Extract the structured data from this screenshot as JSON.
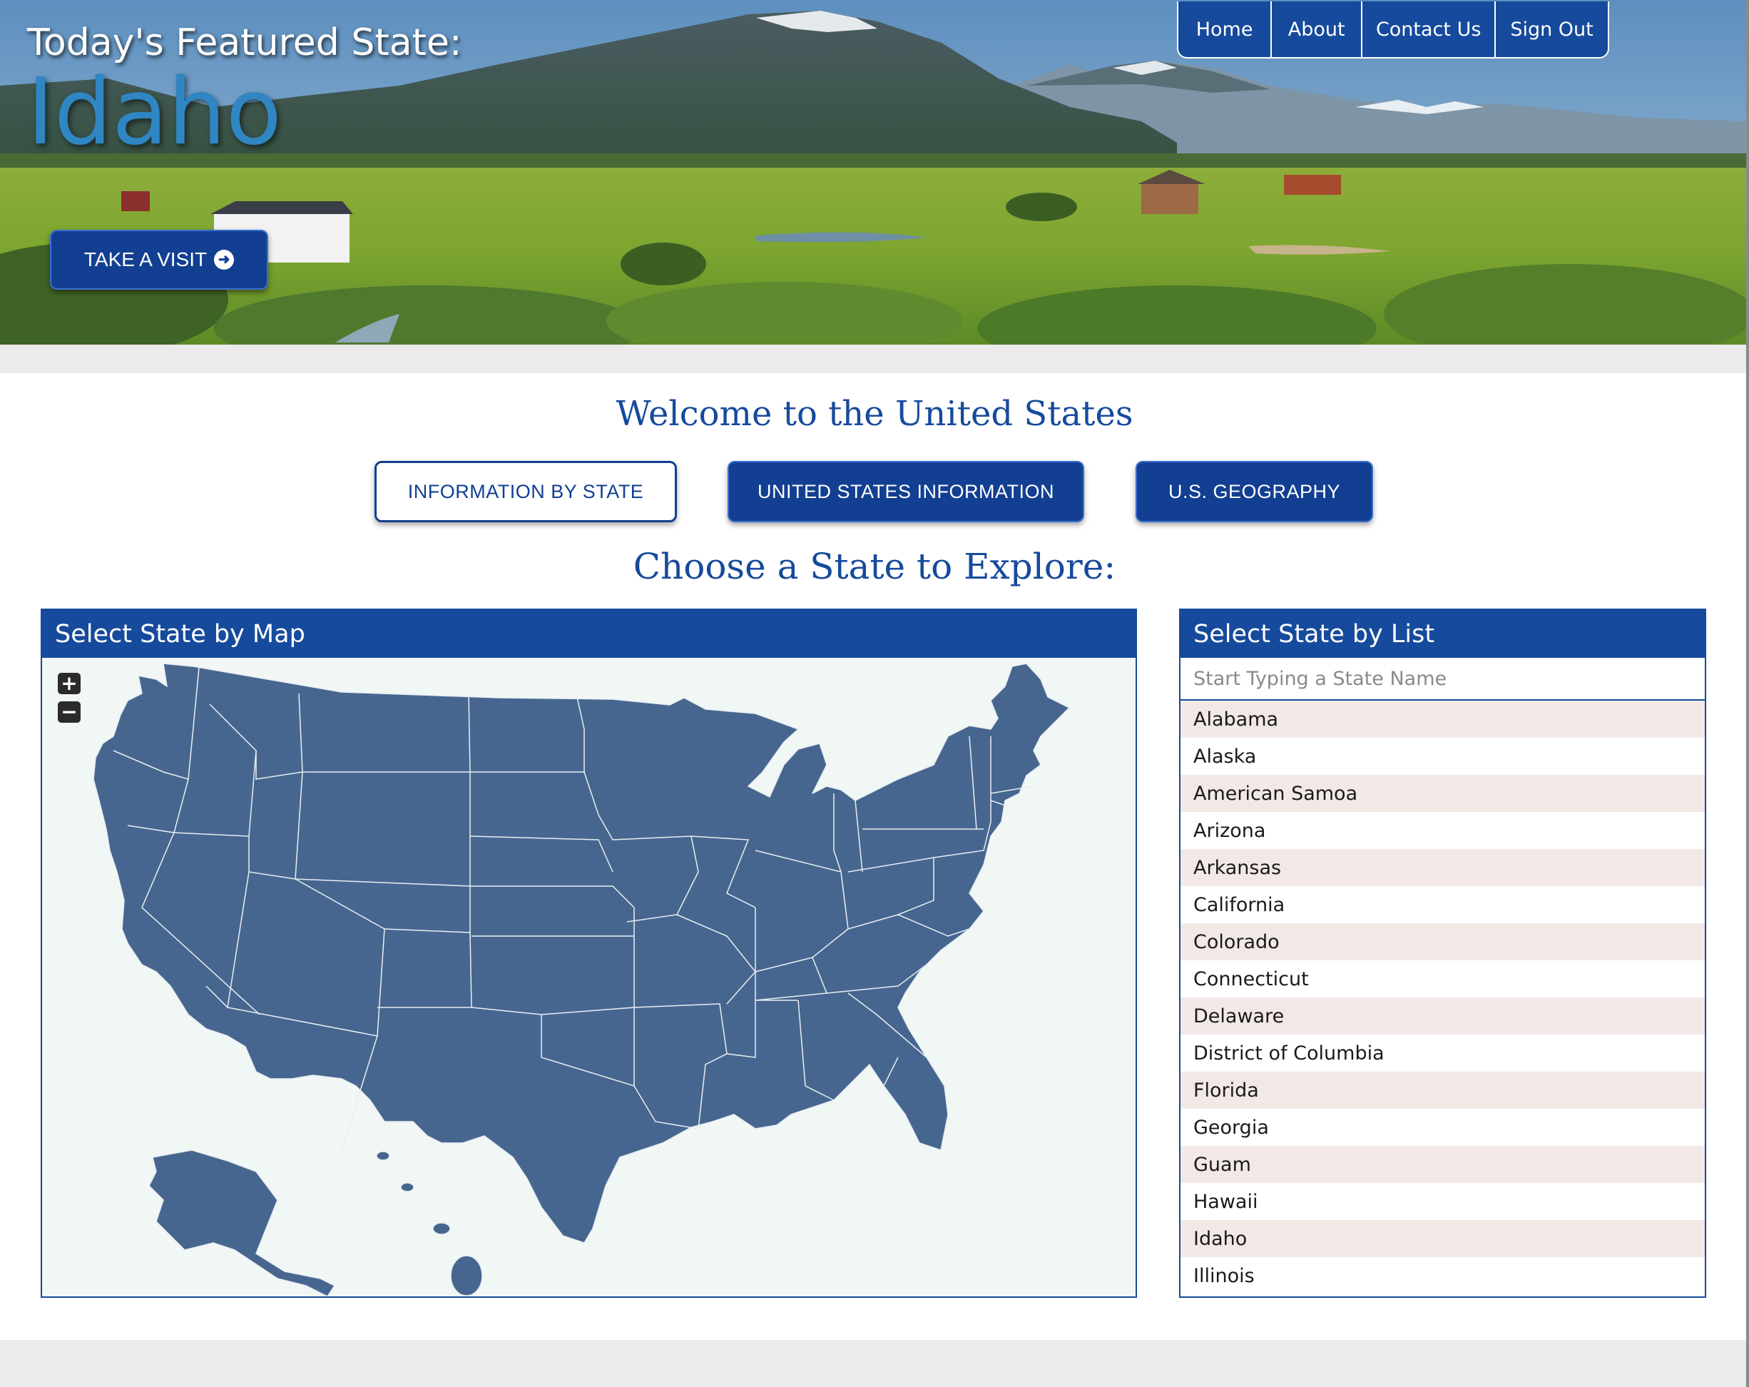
{
  "hero": {
    "featured_label": "Today's Featured State:",
    "featured_state": "Idaho",
    "visit_button": "TAKE A VISIT",
    "visit_icon": "arrow-circle-right-icon"
  },
  "nav": {
    "items": [
      "Home",
      "About",
      "Contact Us",
      "Sign Out"
    ]
  },
  "main": {
    "welcome_heading": "Welcome to the United States",
    "tabs": [
      {
        "label": "INFORMATION BY STATE",
        "active": true
      },
      {
        "label": "UNITED STATES INFORMATION",
        "active": false
      },
      {
        "label": "U.S. GEOGRAPHY",
        "active": false
      }
    ],
    "choose_heading": "Choose a State to Explore:"
  },
  "map_panel": {
    "title": "Select State by Map",
    "zoom_in": "+",
    "zoom_out": "−"
  },
  "list_panel": {
    "title": "Select State by List",
    "search_placeholder": "Start Typing a State Name",
    "states": [
      "Alabama",
      "Alaska",
      "American Samoa",
      "Arizona",
      "Arkansas",
      "California",
      "Colorado",
      "Connecticut",
      "Delaware",
      "District of Columbia",
      "Florida",
      "Georgia",
      "Guam",
      "Hawaii",
      "Idaho",
      "Illinois"
    ]
  },
  "colors": {
    "brand_blue": "#164a9c",
    "button_blue": "#123f91",
    "map_fill": "#47668f",
    "featured_state_blue": "#2f86c2",
    "list_row_alt": "#f2e9e7"
  }
}
